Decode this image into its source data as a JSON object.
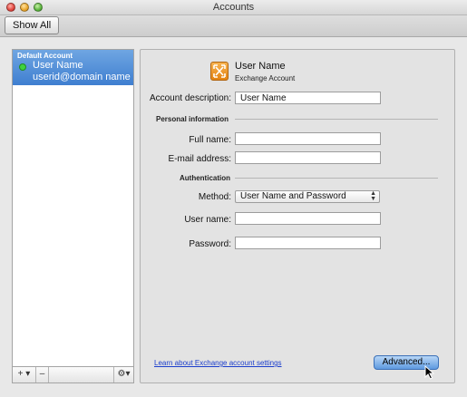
{
  "window": {
    "title": "Accounts"
  },
  "toolbar": {
    "show_all_label": "Show All"
  },
  "sidebar": {
    "group_label": "Default Account",
    "account_name": "User Name",
    "account_email": "userid@domain name",
    "add_label": "+ ▾",
    "remove_label": "–",
    "action_label": "⚙▾"
  },
  "account": {
    "name": "User Name",
    "type": "Exchange Account"
  },
  "form": {
    "description_label": "Account description:",
    "description_value": "User Name",
    "personal_section": "Personal information",
    "full_name_label": "Full name:",
    "full_name_value": "",
    "email_label": "E-mail address:",
    "email_value": "",
    "auth_section": "Authentication",
    "method_label": "Method:",
    "method_value": "User Name and Password",
    "username_label": "User name:",
    "username_value": "",
    "password_label": "Password:",
    "password_value": ""
  },
  "footer": {
    "learn_link": "Learn about Exchange account settings",
    "advanced_label": "Advanced..."
  },
  "colors": {
    "selection": "#3f7fd0",
    "link": "#1a3dcc",
    "exchange_icon": "#e48312",
    "online_status": "#3fd23f"
  },
  "icons": {
    "account_icon": "exchange-icon",
    "status": "online-status-icon",
    "action": "gear-icon"
  }
}
